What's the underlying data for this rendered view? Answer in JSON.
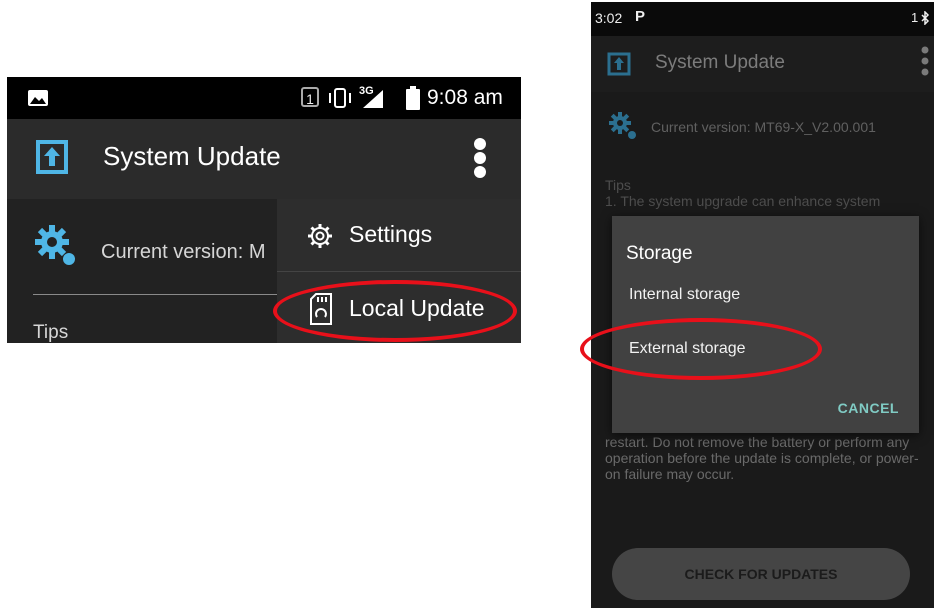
{
  "left_screen": {
    "statusbar": {
      "sim": "1",
      "network": "3G",
      "time": "9:08 am"
    },
    "appbar": {
      "title": "System Update"
    },
    "content": {
      "version_text": "Current version: M",
      "tips_heading": "Tips"
    },
    "menu": {
      "items": [
        {
          "label": "Settings",
          "icon": "gear-icon"
        },
        {
          "label": "Local Update",
          "icon": "sd-card-icon"
        }
      ]
    }
  },
  "right_screen": {
    "statusbar": {
      "time": "3:02",
      "app_indicator": "P",
      "right_indicator": "1"
    },
    "appbar": {
      "title": "System Update"
    },
    "content": {
      "version_text": "Current version: MT69-X_V2.00.001",
      "tips_heading": "Tips",
      "tips_line1": "1. The system upgrade can enhance system",
      "tips_bottom": "restart. Do not remove the battery or perform any operation before the update is complete, or power-on failure may occur."
    },
    "dialog": {
      "title": "Storage",
      "options": [
        "Internal storage",
        "External storage"
      ],
      "cancel": "CANCEL"
    },
    "check_button": "CHECK FOR UPDATES"
  },
  "colors": {
    "accent_icon": "#4fb6e6",
    "annotation": "#e8101a",
    "dialog_action": "#80cbc4"
  }
}
